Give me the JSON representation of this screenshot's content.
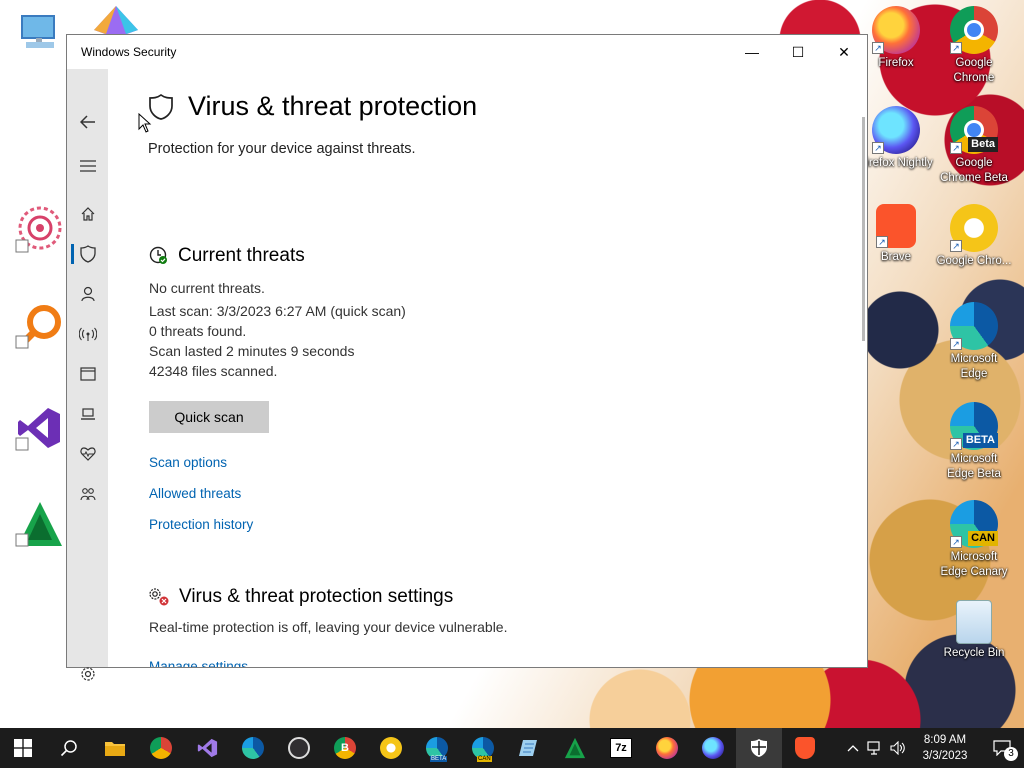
{
  "window": {
    "title": "Windows Security",
    "controls": {
      "minimize": "—",
      "maximize": "☐",
      "close": "✕"
    }
  },
  "page": {
    "title": "Virus & threat protection",
    "subtitle": "Protection for your device against threats."
  },
  "current_threats": {
    "title": "Current threats",
    "status": "No current threats.",
    "last_scan": "Last scan: 3/3/2023 6:27 AM (quick scan)",
    "threats_found": "0 threats found.",
    "scan_duration": "Scan lasted 2 minutes 9 seconds",
    "files_scanned": "42348 files scanned.",
    "quick_scan_button": "Quick scan",
    "links": {
      "scan_options": "Scan options",
      "allowed_threats": "Allowed threats",
      "protection_history": "Protection history"
    }
  },
  "settings_section": {
    "title": "Virus & threat protection settings",
    "status": "Real-time protection is off, leaving your device vulnerable.",
    "manage_link": "Manage settings"
  },
  "sidebar": {
    "items": [
      {
        "name": "back",
        "icon": "back-arrow-icon"
      },
      {
        "name": "menu",
        "icon": "hamburger-icon"
      },
      {
        "name": "home",
        "icon": "home-icon"
      },
      {
        "name": "virus-protection",
        "icon": "shield-icon",
        "active": true
      },
      {
        "name": "account-protection",
        "icon": "person-icon"
      },
      {
        "name": "firewall",
        "icon": "wireless-icon"
      },
      {
        "name": "app-browser-control",
        "icon": "browser-window-icon"
      },
      {
        "name": "device-security",
        "icon": "laptop-icon"
      },
      {
        "name": "device-performance",
        "icon": "heart-icon"
      },
      {
        "name": "family-options",
        "icon": "family-icon"
      },
      {
        "name": "settings",
        "icon": "gear-icon"
      }
    ]
  },
  "desktop": {
    "icons_right": [
      {
        "label": "Firefox",
        "icon": "firefox-icon"
      },
      {
        "label": "Google Chrome",
        "icon": "chrome-icon"
      },
      {
        "label": "Firefox Nightly",
        "icon": "firefox-nightly-icon"
      },
      {
        "label": "Google Chrome Beta",
        "icon": "chrome-beta-icon",
        "tag": "Beta"
      },
      {
        "label": "Brave",
        "icon": "brave-icon"
      },
      {
        "label": "Google Chro...",
        "icon": "chrome-canary-icon"
      },
      {
        "label": "Microsoft Edge",
        "icon": "edge-icon"
      },
      {
        "label": "Microsoft Edge Beta",
        "icon": "edge-beta-icon",
        "tag": "BETA"
      },
      {
        "label": "Microsoft Edge Canary",
        "icon": "edge-canary-icon",
        "tag": "CAN"
      },
      {
        "label": "Recycle Bin",
        "icon": "recycle-bin-icon"
      }
    ],
    "icons_left": [
      {
        "icon": "this-pc-icon"
      },
      {
        "icon": "app-launcher-icon"
      },
      {
        "icon": "mandala-app-icon"
      },
      {
        "icon": "search-magnifier-app-icon"
      },
      {
        "icon": "visual-studio-icon"
      },
      {
        "icon": "triangle-app-icon"
      }
    ]
  },
  "taskbar": {
    "items": [
      "windows-start-icon",
      "search-icon",
      "file-explorer-icon",
      "chrome-icon",
      "visual-studio-icon",
      "edge-icon",
      "obs-icon",
      "chrome-beta-icon",
      "chrome-canary-icon",
      "edge-beta-icon",
      "edge-canary-icon",
      "notepad-icon",
      "triangle-app-icon",
      "7zip-icon",
      "firefox-icon",
      "firefox-nightly-icon",
      "windows-security-icon",
      "brave-icon"
    ],
    "sevenzip_label": "7z",
    "edge_beta_tag": "BETA",
    "edge_canary_tag": "CAN",
    "chrome_beta_tag": "B",
    "time": "8:09 AM",
    "date": "3/3/2023",
    "notification_count": "3"
  },
  "colors": {
    "accent": "#0063b1",
    "sidebar_bg": "#e6e6e6",
    "button_bg": "#cccccc",
    "taskbar_bg": "#1c1c1c",
    "warning_red": "#d13438"
  }
}
